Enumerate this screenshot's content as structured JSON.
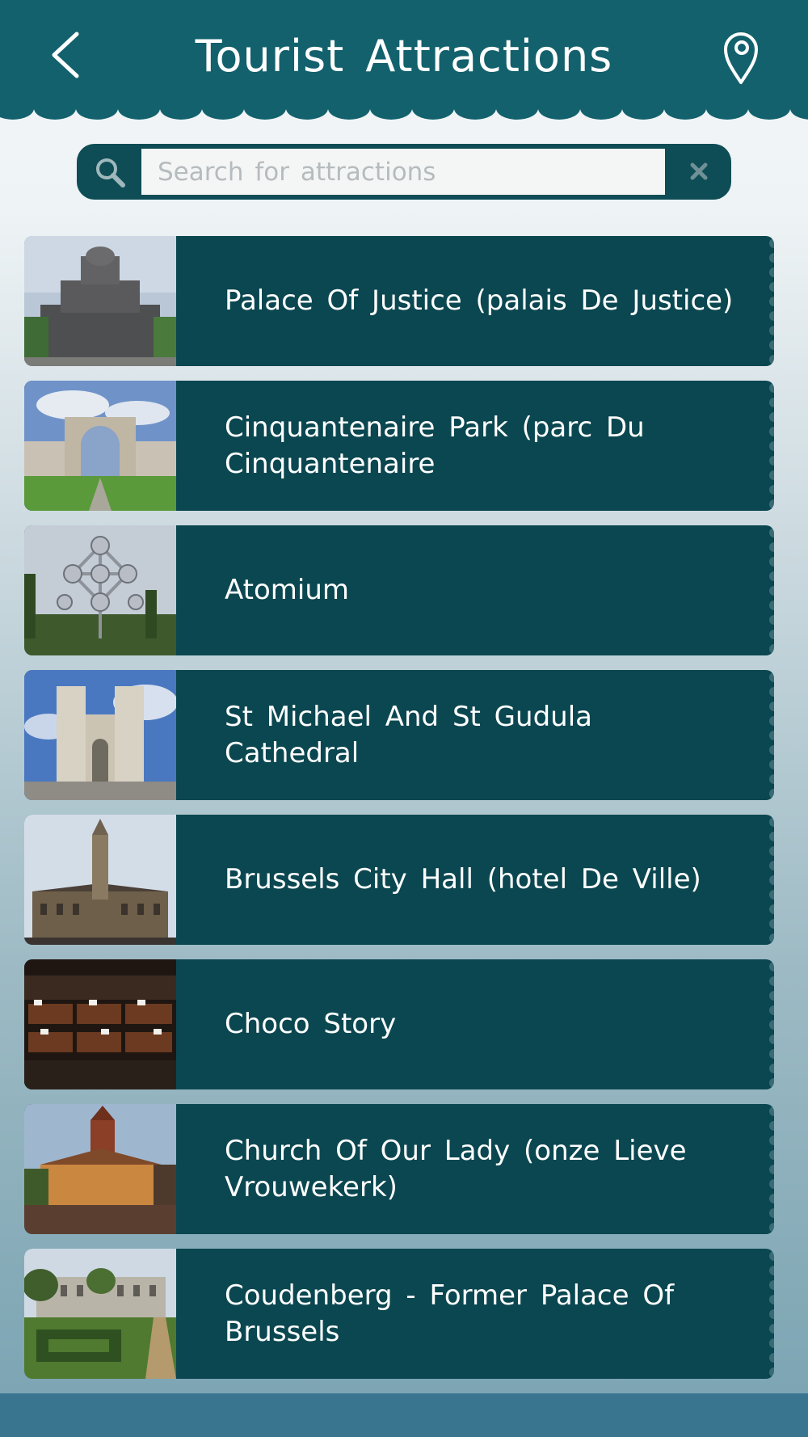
{
  "header": {
    "title": "Tourist Attractions",
    "back_icon": "chevron-left-icon",
    "map_icon": "map-pin-icon",
    "color": "#12616c"
  },
  "search": {
    "placeholder": "Search for attractions",
    "value": "",
    "search_icon": "search-icon",
    "clear_icon": "close-icon"
  },
  "attractions": [
    {
      "name": "Palace Of Justice (palais De Justice)",
      "thumbnail": "palace-of-justice-photo"
    },
    {
      "name": "Cinquantenaire Park (parc Du Cinquantenaire",
      "thumbnail": "cinquantenaire-arch-photo"
    },
    {
      "name": "Atomium",
      "thumbnail": "atomium-photo"
    },
    {
      "name": "St Michael And St Gudula Cathedral",
      "thumbnail": "cathedral-photo"
    },
    {
      "name": "Brussels City Hall (hotel De Ville)",
      "thumbnail": "city-hall-photo"
    },
    {
      "name": "Choco Story",
      "thumbnail": "chocolates-photo"
    },
    {
      "name": "Church Of Our Lady (onze Lieve Vrouwekerk)",
      "thumbnail": "church-photo"
    },
    {
      "name": "Coudenberg - Former Palace Of Brussels",
      "thumbnail": "coudenberg-garden-photo"
    }
  ],
  "colors": {
    "row_background": "#0b4750",
    "search_background": "#0e4d55",
    "footer": "#3a7590"
  }
}
